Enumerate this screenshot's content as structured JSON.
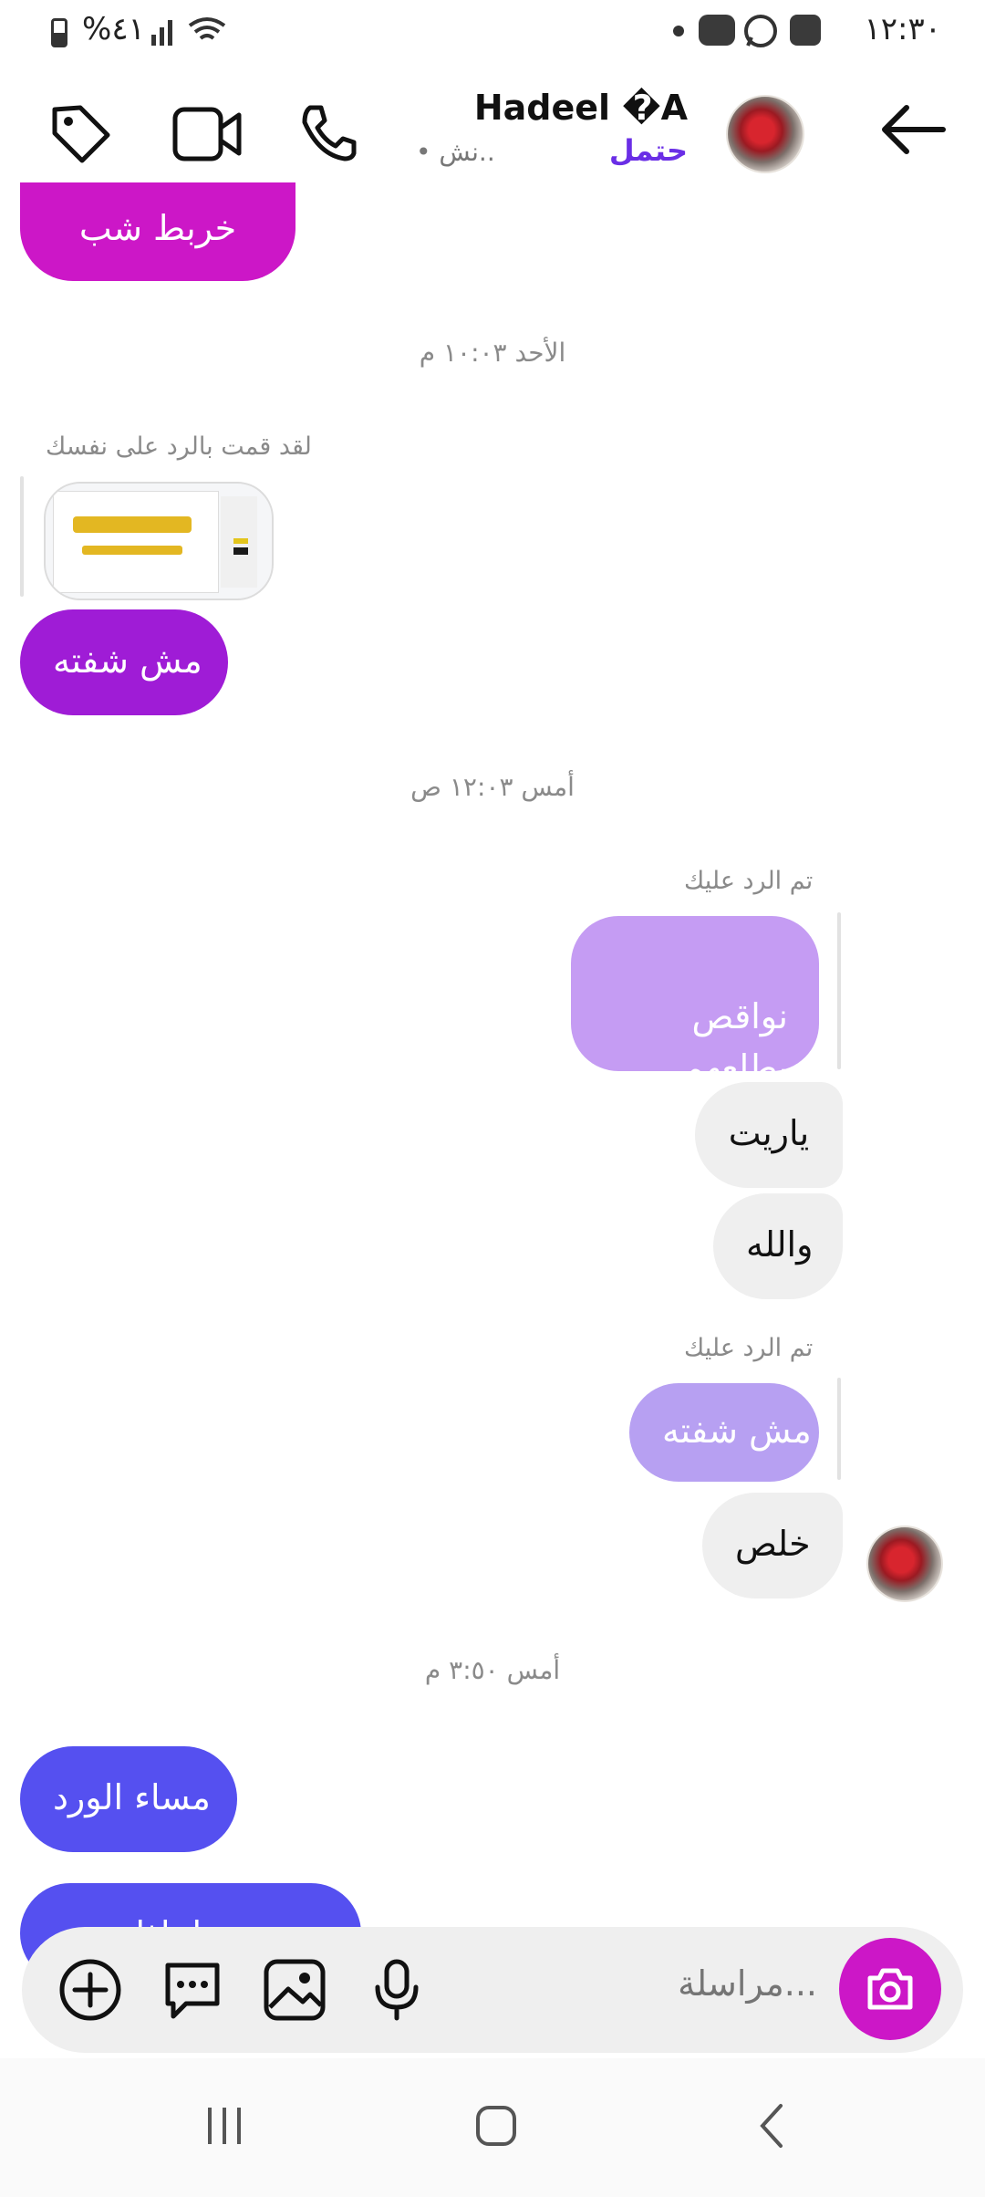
{
  "status_bar": {
    "time": "١٢:٣٠",
    "battery": "%٤١",
    "icons": [
      "gallery-icon",
      "whatsapp-icon",
      "youtube-icon",
      "wifi-icon",
      "signal-icon",
      "battery-icon"
    ]
  },
  "header": {
    "contact_name": "Hadeel �A",
    "active_status": "حتمل",
    "activity_text": "• نش..",
    "icons": [
      "back-arrow-icon",
      "phone-icon",
      "video-icon",
      "tag-icon"
    ]
  },
  "messages": {
    "partial_top": "خربط شب",
    "stamp_1": "الأحد ١٠:٠٣ م",
    "reply_note_self": "لقد قمت بالرد على نفسك",
    "msg_not_seen": "مش شفته",
    "stamp_2": "أمس ١٢:٠٣ ص",
    "reply_note_1": "تم الرد عليك",
    "quoted_1": "نواقص بطلعهم\nخربط شب",
    "msg_yareet": "ياريت",
    "msg_wallah": "والله",
    "reply_note_2": "تم الرد عليك",
    "quoted_2": "مش شفته",
    "msg_khalas": "خلص",
    "stamp_3": "أمس ٣:٥٠ م",
    "msg_evening": "مساء الورد",
    "msg_partial_bottom": "لماذا ... "
  },
  "composer": {
    "placeholder": "مراسلة...",
    "icons": [
      "camera-icon",
      "microphone-icon",
      "gallery-icon",
      "chat-bubble-icon",
      "add-icon"
    ]
  },
  "colors": {
    "pink_magenta": "#cc17c7",
    "purple": "#9f1cd6",
    "lavender_quote": "#c59cf3",
    "lavender_quote_2": "#b7a0f2",
    "indigo": "#5550f0",
    "grey_bubble": "#efefef"
  }
}
